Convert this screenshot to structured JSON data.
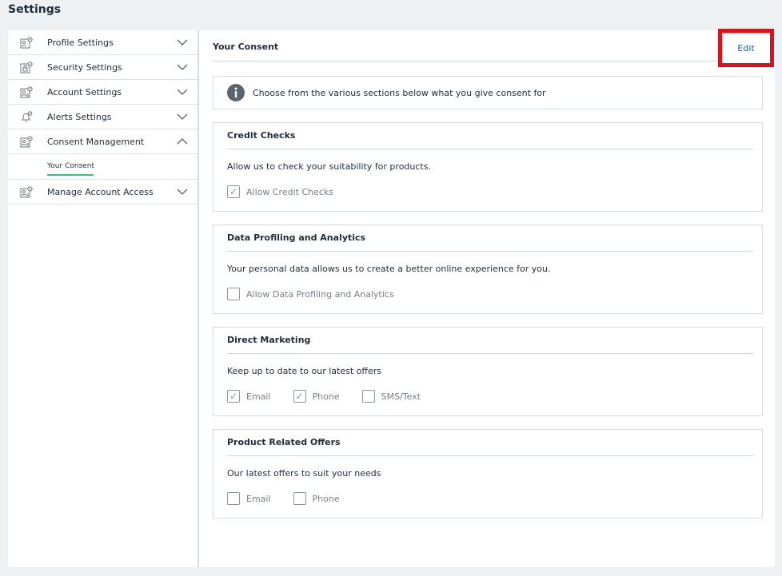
{
  "page": {
    "title": "Settings"
  },
  "sidebar": {
    "items": [
      {
        "label": "Profile Settings",
        "icon": "profile-settings-icon",
        "expanded": false
      },
      {
        "label": "Security Settings",
        "icon": "security-settings-icon",
        "expanded": false
      },
      {
        "label": "Account Settings",
        "icon": "account-settings-icon",
        "expanded": false
      },
      {
        "label": "Alerts Settings",
        "icon": "bell-icon",
        "expanded": false
      },
      {
        "label": "Consent Management",
        "icon": "consent-management-icon",
        "expanded": true
      },
      {
        "label": "Manage Account Access",
        "icon": "account-access-icon",
        "expanded": false
      }
    ],
    "sub_item": {
      "label": "Your Consent",
      "active": true
    }
  },
  "content": {
    "title": "Your Consent",
    "edit_label": "Edit",
    "info_text": "Choose from the various sections below what you give consent for",
    "sections": [
      {
        "title": "Credit Checks",
        "description": "Allow us to check your suitability for products.",
        "options": [
          {
            "label": "Allow Credit Checks",
            "checked": true
          }
        ]
      },
      {
        "title": "Data Profiling and Analytics",
        "description": "Your personal data allows us to create a better online experience for you.",
        "options": [
          {
            "label": "Allow Data Profiling and Analytics",
            "checked": false
          }
        ]
      },
      {
        "title": "Direct Marketing",
        "description": "Keep up to date to our latest offers",
        "options": [
          {
            "label": "Email",
            "checked": true
          },
          {
            "label": "Phone",
            "checked": true
          },
          {
            "label": "SMS/Text",
            "checked": false
          }
        ]
      },
      {
        "title": "Product Related Offers",
        "description": "Our latest offers to suit your needs",
        "options": [
          {
            "label": "Email",
            "checked": false
          },
          {
            "label": "Phone",
            "checked": false
          }
        ]
      }
    ]
  },
  "colors": {
    "accent": "#3bbf8e",
    "link": "#1a5fa8",
    "highlight": "#e0101b"
  }
}
